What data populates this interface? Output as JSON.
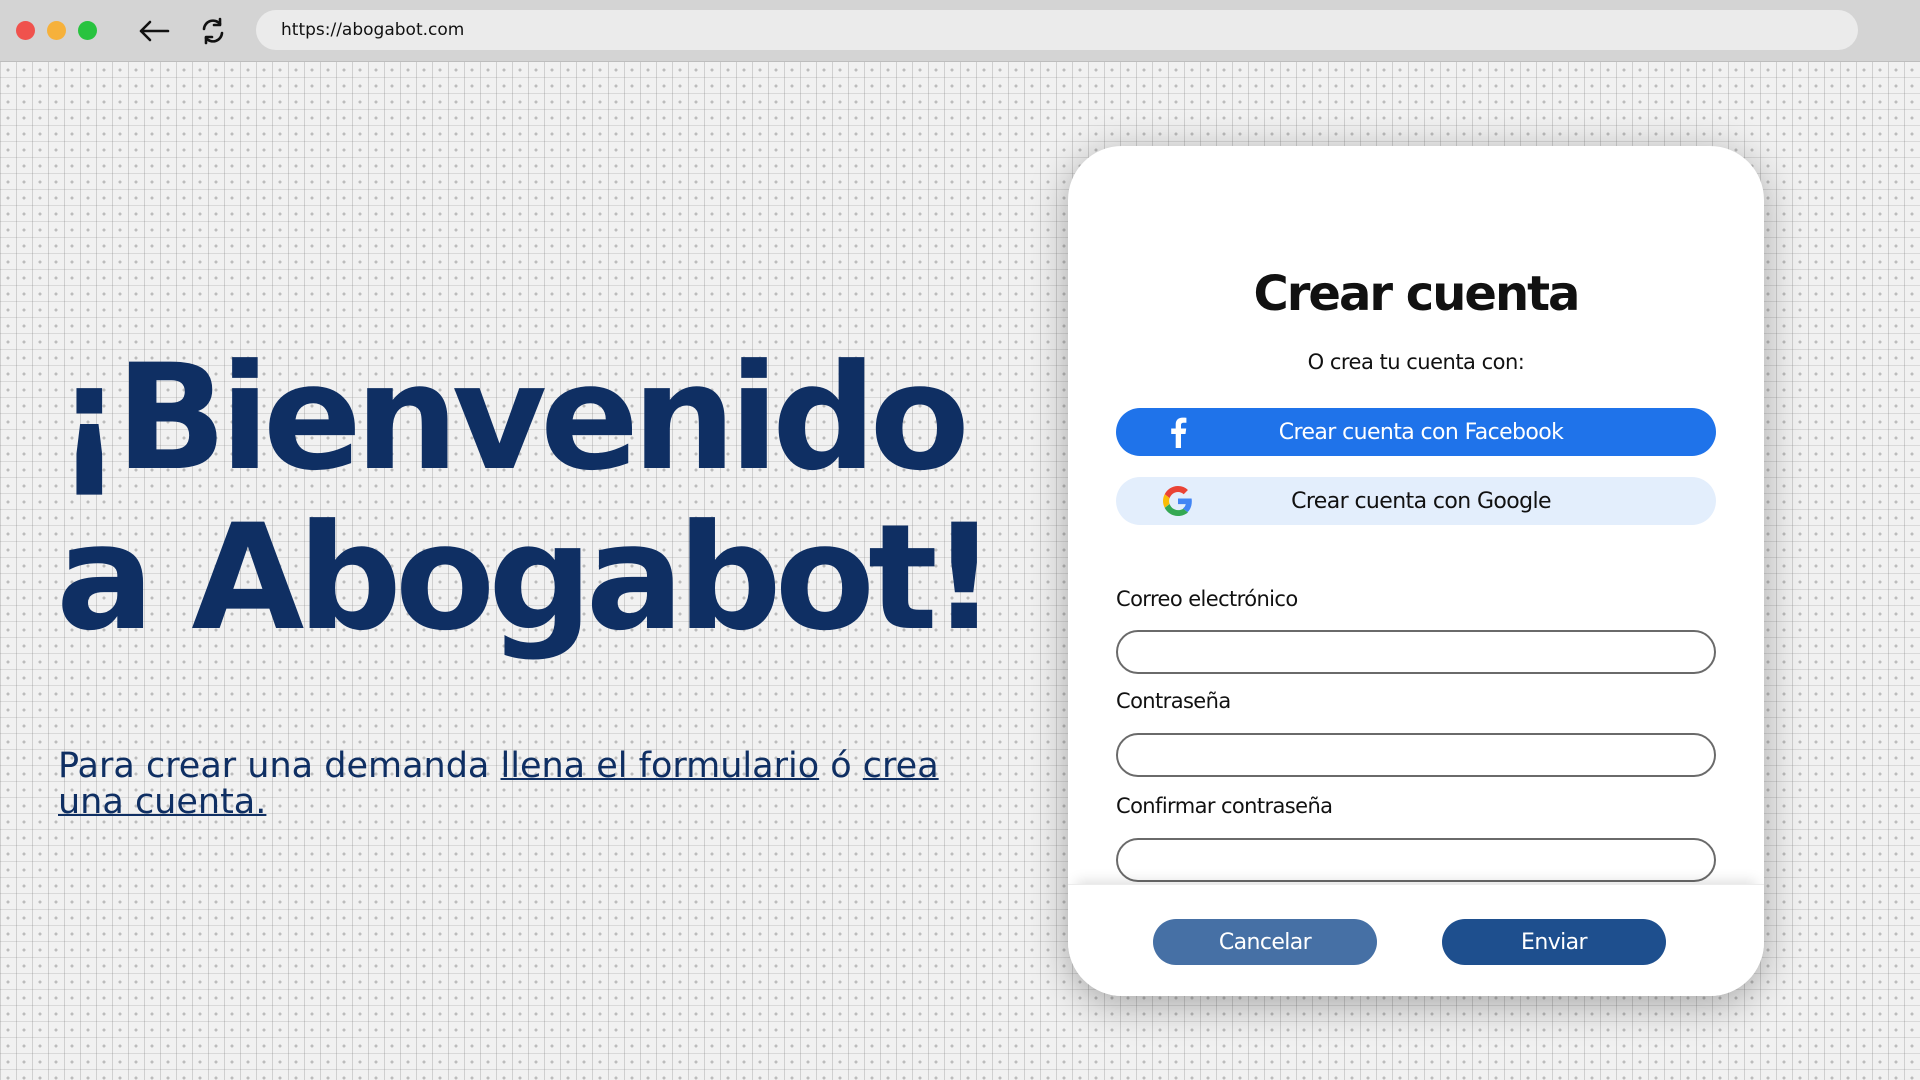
{
  "browser": {
    "url": "https://abogabot.com"
  },
  "hero": {
    "title": "¡Bienvenido a Abogabot!",
    "text_prefix": "Para crear una demanda ",
    "link_form": "llena el formulario",
    "text_middle": " ó ",
    "link_account": "crea una cuenta."
  },
  "card": {
    "title": "Crear cuenta",
    "subtitle": "O crea tu cuenta con:",
    "facebook_label": "Crear cuenta con Facebook",
    "google_label": "Crear cuenta con Google",
    "email_label": "Correo electrónico",
    "email_value": "",
    "password_label": "Contraseña",
    "password_value": "",
    "confirm_label": "Confirmar contraseña",
    "confirm_value": "",
    "cancel_label": "Cancelar",
    "send_label": "Enviar"
  },
  "colors": {
    "brand_navy": "#0f2f63",
    "facebook_blue": "#1f73ea",
    "google_bg": "#e3eefc",
    "cancel_button": "#4670a5",
    "send_button": "#1e4f8e"
  },
  "icons": {
    "back": "arrow-left-icon",
    "reload": "reload-icon",
    "facebook": "facebook-icon",
    "google": "google-icon"
  }
}
